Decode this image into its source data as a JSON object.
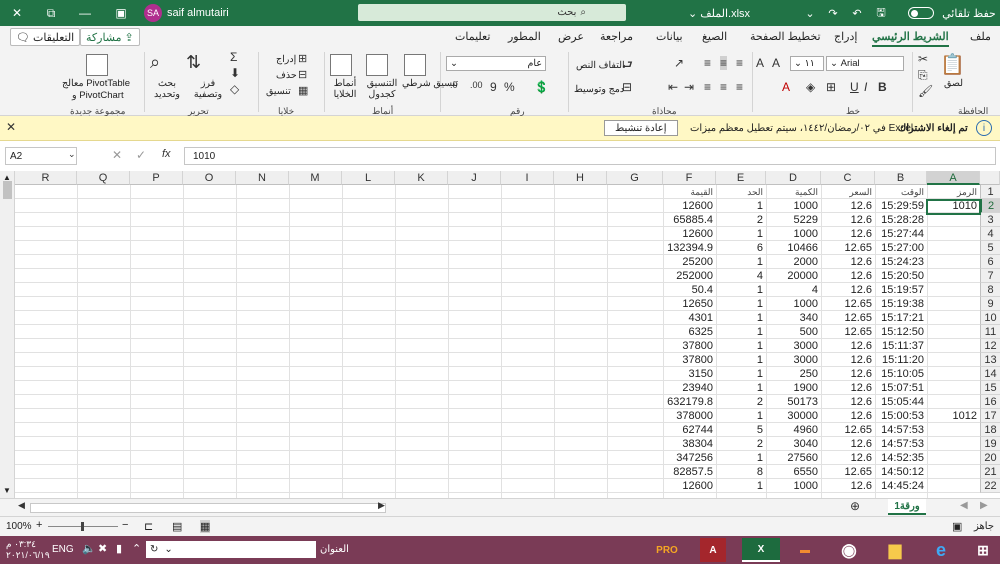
{
  "titlebar": {
    "autosave_label": "حفظ تلقائي",
    "file_name": "الملف.xlsx",
    "search_placeholder": "بحث",
    "user_name": "saif almutairi",
    "user_initials": "SA"
  },
  "tabs": [
    {
      "label": "ملف"
    },
    {
      "label": "الشريط الرئيسي",
      "active": true
    },
    {
      "label": "إدراج"
    },
    {
      "label": "تخطيط الصفحة"
    },
    {
      "label": "الصيغ"
    },
    {
      "label": "بيانات"
    },
    {
      "label": "مراجعة"
    },
    {
      "label": "عرض"
    },
    {
      "label": "المطور"
    },
    {
      "label": "تعليمات"
    }
  ],
  "top_buttons": {
    "share": "مشاركة",
    "comments": "التعليقات"
  },
  "ribbon": {
    "groups": {
      "clipboard": "الحافظة",
      "font": "خط",
      "alignment": "محاذاة",
      "number": "رقم",
      "styles": "أنماط",
      "cells": "خلايا",
      "editing": "تحرير",
      "new_group": "مجموعة جديدة"
    },
    "paste_label": "لصق",
    "font_name": "Arial",
    "font_size": "١١",
    "wrap_text": "التفاف النص",
    "merge_center": "دمج وتوسيط",
    "number_format": "عام",
    "conditional_formatting": "تنسيق شرطي",
    "format_as_table": "التنسيق كجدول",
    "cell_styles": "أنماط الخلايا",
    "insert": "إدراج",
    "delete": "حذف",
    "format": "تنسيق",
    "sort_filter": "فرز وتصفية",
    "find_select": "بحث وتحديد",
    "pivot_line1": "معالج PivotTable",
    "pivot_line2": "و PivotChart"
  },
  "message_bar": {
    "title": "تم إلغاء الاشتراك",
    "text": "في ٠٢/رمضان/١٤٤٢، سيتم تعطيل معظم ميزات Excel.",
    "button": "إعادة تنشيط"
  },
  "formula_bar": {
    "name_box": "A2",
    "formula": "1010",
    "fx": "fx"
  },
  "columns": [
    "R",
    "Q",
    "P",
    "O",
    "N",
    "M",
    "L",
    "K",
    "J",
    "I",
    "H",
    "G",
    "F",
    "E",
    "D",
    "C",
    "B",
    "A"
  ],
  "header_row": [
    "الرمز",
    "الوقت",
    "السعر",
    "الكمية",
    "الحد",
    "القيمة"
  ],
  "rows": [
    {
      "n": "2",
      "A": "1010",
      "B": "15:29:59",
      "C": "12.6",
      "D": "1000",
      "E": "1",
      "F": "12600"
    },
    {
      "n": "3",
      "A": "",
      "B": "15:28:28",
      "C": "12.6",
      "D": "5229",
      "E": "2",
      "F": "65885.4"
    },
    {
      "n": "4",
      "A": "",
      "B": "15:27:44",
      "C": "12.6",
      "D": "1000",
      "E": "1",
      "F": "12600"
    },
    {
      "n": "5",
      "A": "",
      "B": "15:27:00",
      "C": "12.65",
      "D": "10466",
      "E": "6",
      "F": "132394.9"
    },
    {
      "n": "6",
      "A": "",
      "B": "15:24:23",
      "C": "12.6",
      "D": "2000",
      "E": "1",
      "F": "25200"
    },
    {
      "n": "7",
      "A": "",
      "B": "15:20:50",
      "C": "12.6",
      "D": "20000",
      "E": "4",
      "F": "252000"
    },
    {
      "n": "8",
      "A": "",
      "B": "15:19:57",
      "C": "12.6",
      "D": "4",
      "E": "1",
      "F": "50.4"
    },
    {
      "n": "9",
      "A": "",
      "B": "15:19:38",
      "C": "12.65",
      "D": "1000",
      "E": "1",
      "F": "12650"
    },
    {
      "n": "10",
      "A": "",
      "B": "15:17:21",
      "C": "12.65",
      "D": "340",
      "E": "1",
      "F": "4301"
    },
    {
      "n": "11",
      "A": "",
      "B": "15:12:50",
      "C": "12.65",
      "D": "500",
      "E": "1",
      "F": "6325"
    },
    {
      "n": "12",
      "A": "",
      "B": "15:11:37",
      "C": "12.6",
      "D": "3000",
      "E": "1",
      "F": "37800"
    },
    {
      "n": "13",
      "A": "",
      "B": "15:11:20",
      "C": "12.6",
      "D": "3000",
      "E": "1",
      "F": "37800"
    },
    {
      "n": "14",
      "A": "",
      "B": "15:10:05",
      "C": "12.6",
      "D": "250",
      "E": "1",
      "F": "3150"
    },
    {
      "n": "15",
      "A": "",
      "B": "15:07:51",
      "C": "12.6",
      "D": "1900",
      "E": "1",
      "F": "23940"
    },
    {
      "n": "16",
      "A": "",
      "B": "15:05:44",
      "C": "12.6",
      "D": "50173",
      "E": "2",
      "F": "632179.8"
    },
    {
      "n": "17",
      "A": "1012",
      "B": "15:00:53",
      "C": "12.6",
      "D": "30000",
      "E": "1",
      "F": "378000"
    },
    {
      "n": "18",
      "A": "",
      "B": "14:57:53",
      "C": "12.65",
      "D": "4960",
      "E": "5",
      "F": "62744"
    },
    {
      "n": "19",
      "A": "",
      "B": "14:57:53",
      "C": "12.6",
      "D": "3040",
      "E": "2",
      "F": "38304"
    },
    {
      "n": "20",
      "A": "",
      "B": "14:52:35",
      "C": "12.6",
      "D": "27560",
      "E": "1",
      "F": "347256"
    },
    {
      "n": "21",
      "A": "",
      "B": "14:50:12",
      "C": "12.65",
      "D": "6550",
      "E": "8",
      "F": "82857.5"
    },
    {
      "n": "22",
      "A": "",
      "B": "14:45:24",
      "C": "12.6",
      "D": "1000",
      "E": "1",
      "F": "12600"
    }
  ],
  "sheet_tab": "ورقة1",
  "status": {
    "ready": "جاهز",
    "zoom": "100%"
  },
  "taskbar": {
    "address_label": "العنوان",
    "lang": "ENG",
    "time": "٠٣:٣٤ م",
    "date": "٢٠٢١/٠٦/١٩"
  },
  "colors": {
    "excel_green": "#217346",
    "message_bg": "#fff8c5",
    "taskbar": "#7a3b56"
  }
}
